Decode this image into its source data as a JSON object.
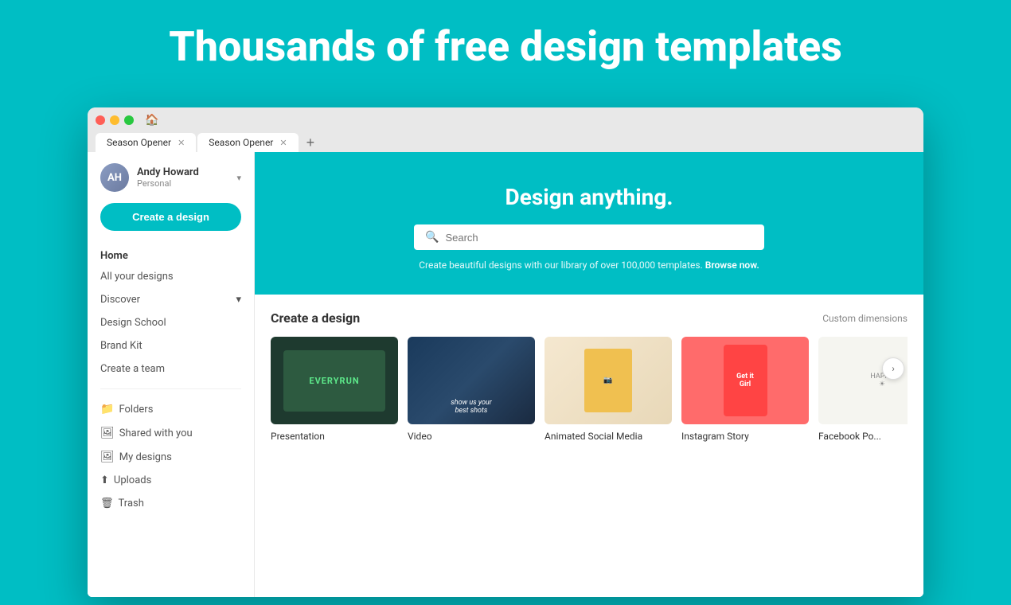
{
  "hero": {
    "title": "Thousands of free design templates"
  },
  "browser": {
    "tabs": [
      {
        "label": "Season Opener",
        "active": false
      },
      {
        "label": "Season Opener",
        "active": true
      }
    ],
    "add_tab_label": "+"
  },
  "sidebar": {
    "user": {
      "name": "Andy Howard",
      "role": "Personal",
      "initials": "AH"
    },
    "create_button": "Create a design",
    "nav": {
      "home": "Home",
      "all_designs": "All your designs",
      "discover": "Discover",
      "design_school": "Design School",
      "brand_kit": "Brand Kit",
      "create_team": "Create a team"
    },
    "folders": {
      "folders": "Folders",
      "shared": "Shared with you",
      "my_designs": "My designs",
      "uploads": "Uploads",
      "trash": "Trash"
    }
  },
  "main": {
    "banner": {
      "title": "Design anything.",
      "search_placeholder": "Search",
      "browse_text": "Create beautiful designs with our library of over 100,000 templates.",
      "browse_link": "Browse now."
    },
    "create_section": {
      "title": "Create a design",
      "custom_dimensions": "Custom dimensions",
      "cards": [
        {
          "label": "Presentation",
          "type": "presentation"
        },
        {
          "label": "Video",
          "type": "video"
        },
        {
          "label": "Animated Social Media",
          "type": "social"
        },
        {
          "label": "Instagram Story",
          "type": "instagram"
        },
        {
          "label": "Facebook Po...",
          "type": "facebook"
        }
      ]
    }
  }
}
